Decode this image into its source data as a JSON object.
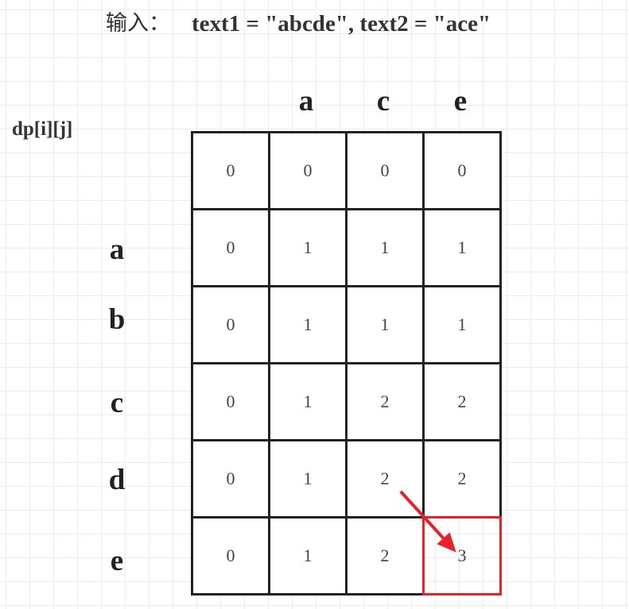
{
  "title": {
    "prefix": "输入：",
    "formula": "text1 = \"abcde\", text2 = \"ace\""
  },
  "table_label": "dp[i][j]",
  "column_headers": [
    "a",
    "c",
    "e"
  ],
  "row_headers": [
    "a",
    "b",
    "c",
    "d",
    "e"
  ],
  "grid": [
    [
      "0",
      "0",
      "0",
      "0"
    ],
    [
      "0",
      "1",
      "1",
      "1"
    ],
    [
      "0",
      "1",
      "1",
      "1"
    ],
    [
      "0",
      "1",
      "2",
      "2"
    ],
    [
      "0",
      "1",
      "2",
      "2"
    ],
    [
      "0",
      "1",
      "2",
      "3"
    ]
  ],
  "highlight": {
    "row": 5,
    "col": 3,
    "color": "#e8202a",
    "from_row": 4,
    "from_col": 2
  }
}
